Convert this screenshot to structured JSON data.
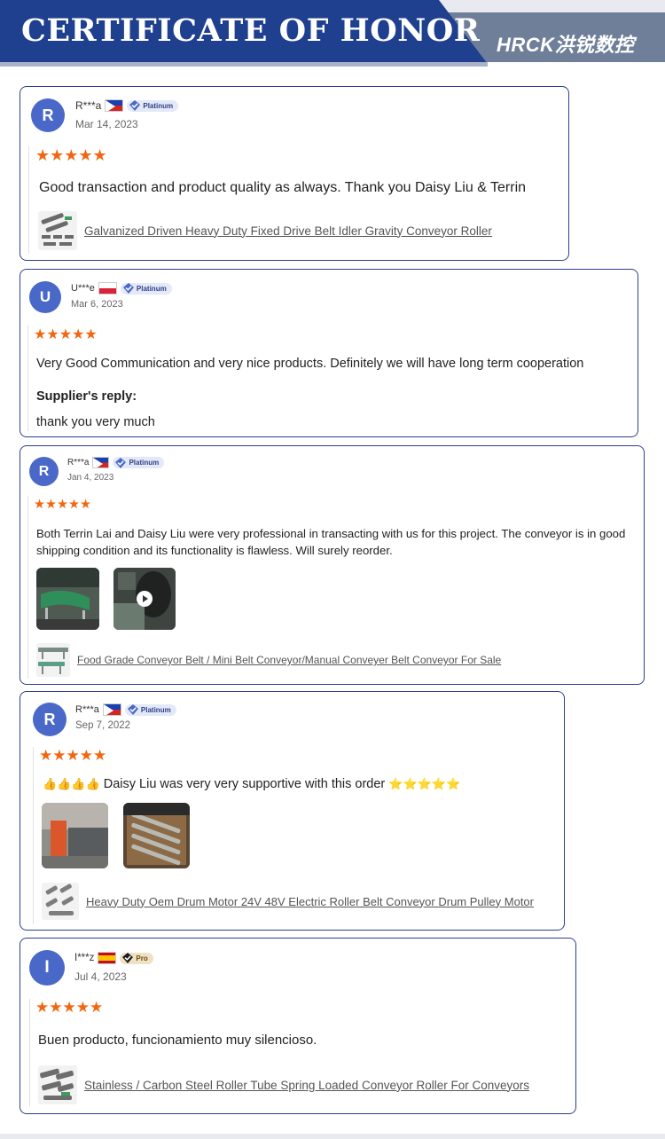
{
  "header": {
    "title": "CERTIFICATE OF HONOR",
    "logo": "HRCK洪锐数控",
    "colors": {
      "primary": "#1f3f8f",
      "secondary": "#6f7f99",
      "star": "#f2660f",
      "avatar": "#4a68c8"
    }
  },
  "reviews": [
    {
      "avatar_letter": "R",
      "user": "R***a",
      "country_flag": "flag-philippines-icon",
      "badge": "Platinum",
      "date": "Mar 14, 2023",
      "rating": 5,
      "stars": "★★★★★",
      "text": "Good transaction and product quality as always. Thank you Daisy Liu & Terrin",
      "product": "Galvanized Driven Heavy Duty Fixed Drive Belt Idler Gravity Conveyor Roller"
    },
    {
      "avatar_letter": "U",
      "user": "U***e",
      "country_flag": "flag-poland-icon",
      "badge": "Platinum",
      "date": "Mar 6, 2023",
      "rating": 5,
      "stars": "★★★★★",
      "text": "Very Good Communication and very nice products. Definitely we will have long term cooperation",
      "reply_title": "Supplier's reply:",
      "reply_text": "thank you very much"
    },
    {
      "avatar_letter": "R",
      "user": "R***a",
      "country_flag": "flag-philippines-icon",
      "badge": "Platinum",
      "date": "Jan 4, 2023",
      "rating": 5,
      "stars": "★★★★★",
      "text": "Both Terrin Lai and Daisy Liu were very professional in transacting with us for this project. The conveyor is in good shipping condition and its functionality is flawless. Will surely reorder.",
      "product": "Food Grade Conveyor Belt / Mini Belt Conveyor/Manual Conveyer Belt Conveyor For Sale"
    },
    {
      "avatar_letter": "R",
      "user": "R***a",
      "country_flag": "flag-philippines-icon",
      "badge": "Platinum",
      "date": "Sep 7, 2022",
      "rating": 5,
      "stars": "★★★★★",
      "text_prefix": "👍👍👍👍",
      "text": "Daisy Liu was very very supportive with this order",
      "text_suffix": "⭐⭐⭐⭐⭐",
      "product": "Heavy Duty Oem Drum Motor 24V 48V Electric Roller Belt Conveyor Drum Pulley Motor"
    },
    {
      "avatar_letter": "I",
      "user": "I***z",
      "country_flag": "flag-spain-icon",
      "badge": "Pro",
      "date": "Jul 4, 2023",
      "rating": 5,
      "stars": "★★★★★",
      "text": "Buen producto, funcionamiento muy silencioso.",
      "product": "Stainless / Carbon Steel Roller Tube Spring Loaded Conveyor Roller For Conveyors"
    }
  ]
}
